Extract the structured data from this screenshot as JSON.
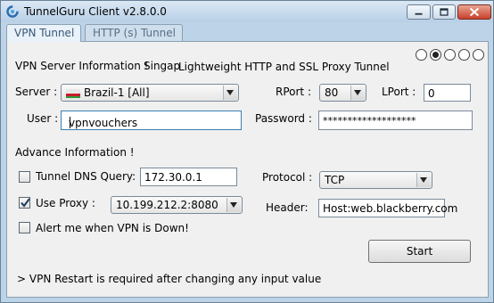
{
  "window": {
    "title": "TunnelGuru Client v2.8.0.0"
  },
  "tabs": [
    {
      "label": "VPN Tunnel",
      "active": true
    },
    {
      "label": "HTTP (s) Tunnel",
      "active": false
    }
  ],
  "server_info": {
    "heading": "VPN Server  Information !",
    "description_clipped": "Singap",
    "description": "Lightweight HTTP and SSL Proxy Tunnel",
    "pager": {
      "pages": 5,
      "selected_index": 1
    }
  },
  "fields": {
    "server": {
      "label": "Server :",
      "value": "Brazil-1 [All]",
      "flag": "brazil-flag"
    },
    "rport": {
      "label": "RPort :",
      "value": "80"
    },
    "lport": {
      "label": "LPort :",
      "value": "0"
    },
    "user": {
      "label": "User :",
      "value": "vpnvouchers"
    },
    "password": {
      "label": "Password :",
      "value": "*******************"
    }
  },
  "advance": {
    "heading": "Advance  Information !",
    "tunnel_dns": {
      "label": "Tunnel DNS Query:",
      "checked": false,
      "value": "172.30.0.1"
    },
    "protocol": {
      "label": "Protocol :",
      "value": "TCP"
    },
    "use_proxy": {
      "label": "Use Proxy :",
      "checked": true,
      "value": "10.199.212.2:8080"
    },
    "header": {
      "label": "Header:",
      "value": "Host:web.blackberry.com"
    },
    "alert": {
      "label": "Alert me when VPN is Down!",
      "checked": false
    }
  },
  "start_button": {
    "label": "Start"
  },
  "footer_note": "> VPN Restart is required after changing any input value",
  "colors": {
    "title_bar": "#c4d7ec",
    "close_button": "#c7412d",
    "panel": "#f0f0f0",
    "tab_text": "#3a5876"
  }
}
